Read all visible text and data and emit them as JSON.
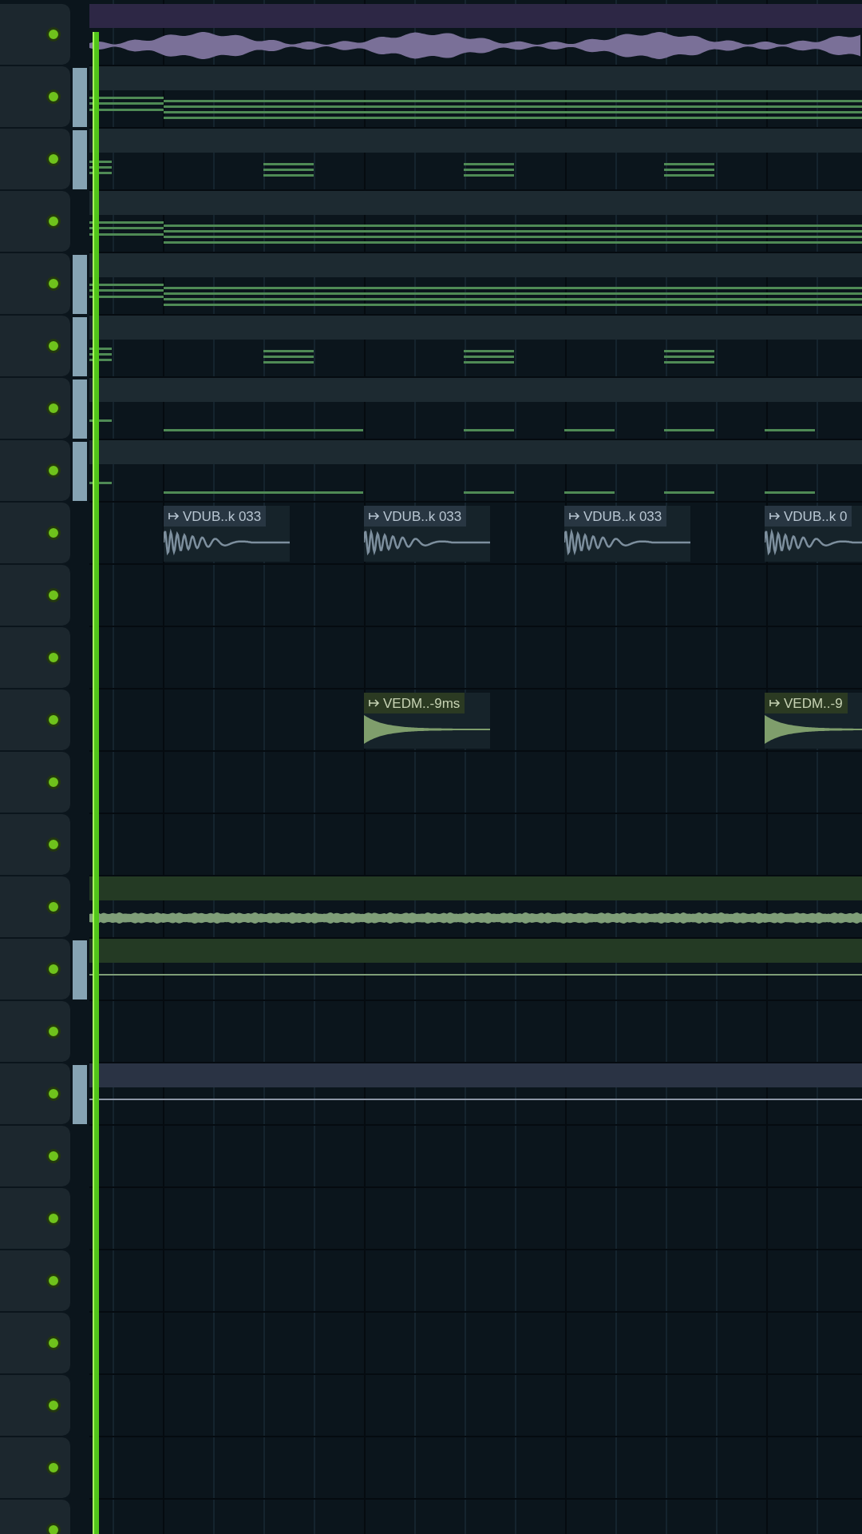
{
  "tracks": [
    {
      "kind": "audio",
      "color": "#7a7098",
      "selected": false
    },
    {
      "kind": "chord-pattern",
      "selected": true
    },
    {
      "kind": "hit-pattern",
      "selected": true
    },
    {
      "kind": "chord-pattern",
      "selected": false
    },
    {
      "kind": "chord-pattern",
      "selected": true
    },
    {
      "kind": "hit-pattern",
      "selected": true
    },
    {
      "kind": "note-pattern",
      "selected": true
    },
    {
      "kind": "note-pattern",
      "selected": true
    },
    {
      "kind": "samples",
      "selected": false,
      "clips": [
        {
          "label": "VDUB..k 033"
        },
        {
          "label": "VDUB..k 033"
        },
        {
          "label": "VDUB..k 033"
        },
        {
          "label": "VDUB..k 0"
        }
      ]
    },
    {
      "kind": "empty",
      "selected": false
    },
    {
      "kind": "empty",
      "selected": false
    },
    {
      "kind": "fx-samples",
      "selected": false,
      "clips": [
        {
          "label": "VEDM..-9ms"
        },
        {
          "label": "VEDM..-9"
        }
      ]
    },
    {
      "kind": "empty",
      "selected": false
    },
    {
      "kind": "empty",
      "selected": false
    },
    {
      "kind": "audio-noise",
      "color": "#7f9e78",
      "selected": false
    },
    {
      "kind": "audio-flat",
      "color": "#7f9e78",
      "selected": true
    },
    {
      "kind": "empty",
      "selected": false
    },
    {
      "kind": "audio-flat",
      "color": "#8d96a6",
      "selected": true
    },
    {
      "kind": "empty",
      "selected": false
    },
    {
      "kind": "empty",
      "selected": false
    },
    {
      "kind": "empty",
      "selected": false
    },
    {
      "kind": "empty",
      "selected": false
    },
    {
      "kind": "empty",
      "selected": false
    },
    {
      "kind": "empty",
      "selected": false
    },
    {
      "kind": "empty",
      "selected": false
    }
  ]
}
